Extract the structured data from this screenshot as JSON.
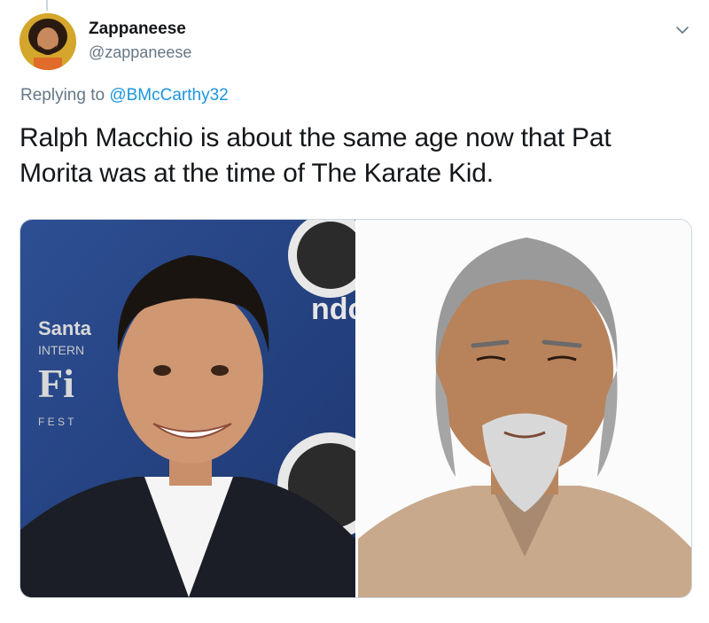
{
  "author": {
    "display_name": "Zappaneese",
    "handle": "@zappaneese",
    "avatar_icon": "profile-photo-avatar"
  },
  "reply_context": {
    "prefix": "Replying to ",
    "mention": "@BMcCarthy32"
  },
  "tweet": {
    "text": "Ralph Macchio is about the same age now that Pat Morita was at the time of The Karate Kid."
  },
  "media": {
    "count": 2,
    "photos": [
      {
        "subject": "smiling man in dark suit at film festival backdrop",
        "backdrop_text_lines": [
          "Santa",
          "INTERN",
          "Fi",
          "F E S T"
        ],
        "logo_text": "ndc"
      },
      {
        "subject": "older man with grey hair and goatee in tan shirt"
      }
    ]
  },
  "colors": {
    "text_primary": "#14171a",
    "text_secondary": "#657786",
    "link": "#1b95e0",
    "border": "#ccd6dd"
  },
  "icons": {
    "menu": "chevron-down-icon"
  }
}
